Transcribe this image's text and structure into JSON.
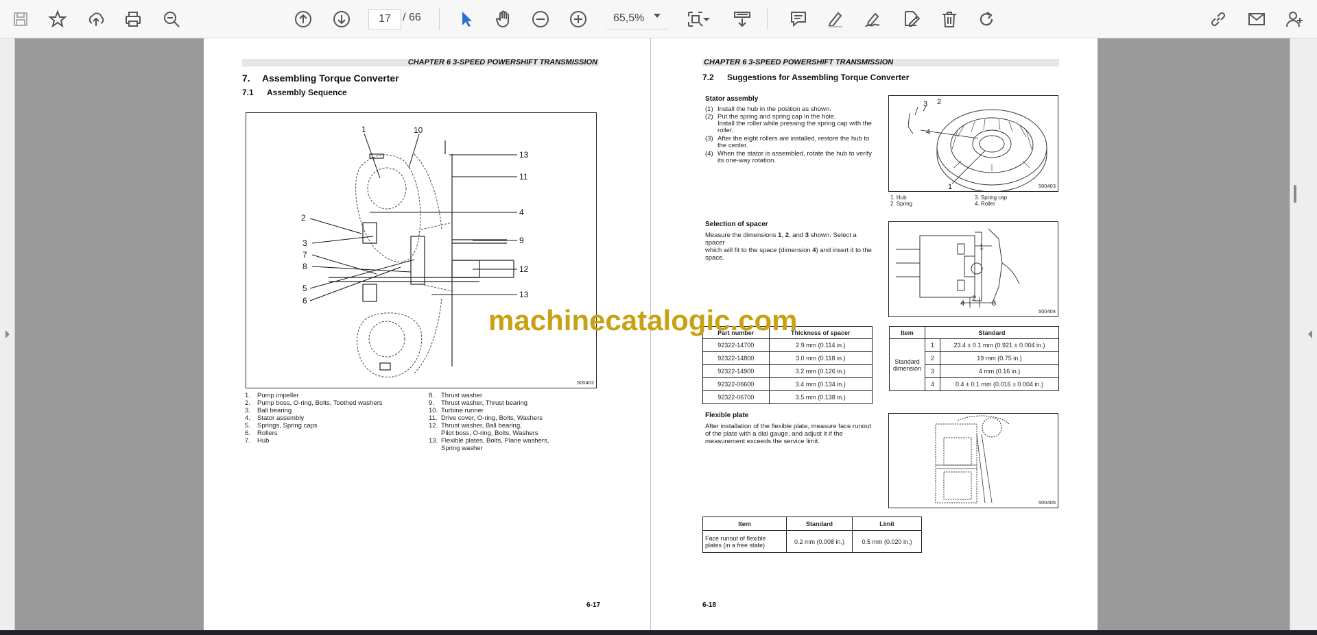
{
  "toolbar": {
    "current_page": "17",
    "page_separator": "/",
    "total_pages": "66",
    "zoom": "65,5%"
  },
  "left_page": {
    "chapter_header": "CHAPTER 6 3-SPEED POWERSHIFT TRANSMISSION",
    "heading_num": "7.",
    "heading": "Assembling Torque Converter",
    "subheading_num": "7.1",
    "subheading": "Assembly Sequence",
    "figure": {
      "id": "500402",
      "callouts": [
        "1",
        "10",
        "13",
        "11",
        "4",
        "2",
        "9",
        "3",
        "7",
        "12",
        "8",
        "5",
        "6",
        "13"
      ]
    },
    "legend_left": [
      {
        "n": "1.",
        "t": "Pump impeller"
      },
      {
        "n": "2.",
        "t": "Pump boss, O-ring, Bolts, Toothed washers"
      },
      {
        "n": "3.",
        "t": "Ball bearing"
      },
      {
        "n": "4.",
        "t": "Stator assembly"
      },
      {
        "n": "5.",
        "t": "Springs, Spring caps"
      },
      {
        "n": "6.",
        "t": "Rollers"
      },
      {
        "n": "7.",
        "t": "Hub"
      }
    ],
    "legend_right": [
      {
        "n": "8.",
        "t": "Thrust washer"
      },
      {
        "n": "9.",
        "t": "Thrust washer, Thrust bearing"
      },
      {
        "n": "10.",
        "t": "Turbine runner"
      },
      {
        "n": "11.",
        "t": "Drive cover, O-ring, Bolts, Washers"
      },
      {
        "n": "12.",
        "t": "Thrust washer, Ball bearing,"
      },
      {
        "n": "",
        "t": "Pilot boss, O-ring, Bolts, Washers"
      },
      {
        "n": "13.",
        "t": "Flexible plates, Bolts, Plane washers,"
      },
      {
        "n": "",
        "t": "Spring washer"
      }
    ],
    "page_number": "6-17"
  },
  "right_page": {
    "chapter_header": "CHAPTER 6 3-SPEED POWERSHIFT TRANSMISSION",
    "heading_num": "7.2",
    "heading": "Suggestions for Assembling Torque Converter",
    "stator": {
      "title": "Stator assembly",
      "steps": [
        {
          "n": "(1)",
          "t": "Install the hub in the position as shown."
        },
        {
          "n": "(2)",
          "t": "Put the spring and spring cap in the hole."
        },
        {
          "n": "",
          "t": "Install the roller while pressing the spring cap with the"
        },
        {
          "n": "",
          "t": "roller."
        },
        {
          "n": "(3)",
          "t": "After the eight rollers are installed, restore the hub to"
        },
        {
          "n": "",
          "t": "the center."
        },
        {
          "n": "(4)",
          "t": "When the stator is assembled, rotate the hub to verify"
        },
        {
          "n": "",
          "t": "its one-way rotation."
        }
      ],
      "figure_id": "500403",
      "callouts": [
        "3",
        "2",
        "4",
        "1"
      ],
      "legend": [
        "1. Hub",
        "2. Spring",
        "3. Spring cap",
        "4. Roller"
      ]
    },
    "spacer": {
      "title": "Selection of spacer",
      "text_1": "Measure the dimensions ",
      "b1": "1",
      "text_2": ", ",
      "b2": "2",
      "text_3": ", and ",
      "b3": "3",
      "text_4": " shown. Select a spacer",
      "line2": "which will fit to the space (dimension ",
      "b4": "4",
      "line2b": ") and insert it to the",
      "line3": "space.",
      "figure_id": "500404",
      "callouts": [
        "1",
        "4",
        "2",
        "3"
      ]
    },
    "spacer_table": {
      "headers": [
        "Part number",
        "Thickness of spacer"
      ],
      "rows": [
        [
          "92322-14700",
          "2.9 mm (0.114 in.)"
        ],
        [
          "92322-14800",
          "3.0 mm (0.118 in.)"
        ],
        [
          "92322-14900",
          "3.2 mm (0.126 in.)"
        ],
        [
          "92322-06600",
          "3.4 mm (0.134 in.)"
        ],
        [
          "92322-06700",
          "3.5 mm (0.138 in.)"
        ]
      ]
    },
    "dimension_table": {
      "headers": [
        "Item",
        "Standard"
      ],
      "row_label_1": "Standard",
      "row_label_2": "dimension",
      "rows": [
        [
          "1",
          "23.4 ± 0.1 mm (0.921 ± 0.004 in.)"
        ],
        [
          "2",
          "19 mm (0.75 in.)"
        ],
        [
          "3",
          "4 mm (0.16 in.)"
        ],
        [
          "4",
          "0.4 ± 0.1 mm (0.016 ± 0.004 in.)"
        ]
      ]
    },
    "flexible": {
      "title": "Flexible plate",
      "lines": [
        "After installation of the flexible plate, measure face runout",
        "of the plate with a dial gauge, and adjust it if the",
        "measurement exceeds the service limit."
      ],
      "figure_id": "500405"
    },
    "runout_table": {
      "headers": [
        "Item",
        "Standard",
        "Limit"
      ],
      "item_line1": "Face runout of flexible",
      "item_line2": "plates (in a free state)",
      "standard": "0.2 mm (0.008 in.)",
      "limit": "0.5 mm (0.020 in.)"
    },
    "page_number": "6-18"
  },
  "watermark": "machinecatalogic.com"
}
